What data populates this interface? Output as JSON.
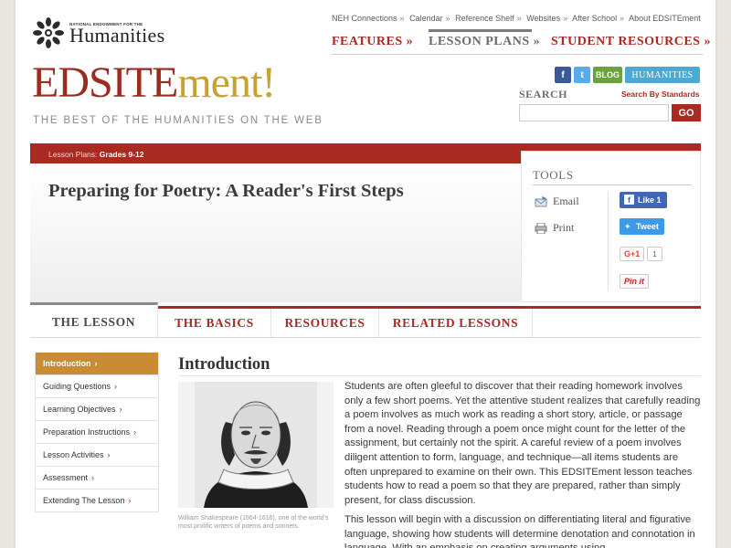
{
  "neh": {
    "small": "NATIONAL ENDOWMENT FOR THE",
    "big": "Humanities"
  },
  "top_links": [
    "NEH Connections",
    "Calendar",
    "Reference Shelf",
    "Websites",
    "After School",
    "About EDSITEment"
  ],
  "main_nav": {
    "features": "FEATURES »",
    "lesson_plans": "LESSON PLANS »",
    "student_resources": "STUDENT RESOURCES »"
  },
  "brand": {
    "part1": "EDSITE",
    "part2": "ment!",
    "tagline": "THE BEST OF THE HUMANITIES ON THE WEB"
  },
  "social": {
    "facebook": "f",
    "twitter": "t",
    "blog": "BLOG",
    "humanities": "HUMANITIES"
  },
  "search": {
    "label": "SEARCH",
    "by_standards": "Search By Standards",
    "placeholder": "",
    "go": "GO"
  },
  "breadcrumb": {
    "prefix": "Lesson Plans:",
    "grades": "Grades 9-12"
  },
  "page_title": "Preparing for Poetry: A Reader's First Steps",
  "tools": {
    "title": "TOOLS",
    "email": "Email",
    "print": "Print",
    "like": "Like 1",
    "tweet": "Tweet",
    "gplus": "G+1",
    "gplus_count": "1",
    "pin": "Pin it"
  },
  "tabs": [
    "THE LESSON",
    "THE BASICS",
    "RESOURCES",
    "RELATED LESSONS"
  ],
  "sidebar": [
    {
      "label": "Introduction"
    },
    {
      "label": "Guiding Questions"
    },
    {
      "label": "Learning Objectives"
    },
    {
      "label": "Preparation Instructions"
    },
    {
      "label": "Lesson Activities"
    },
    {
      "label": "Assessment"
    },
    {
      "label": "Extending The Lesson"
    }
  ],
  "content": {
    "section_title": "Introduction",
    "caption": "William Shakespeare (1564-1616), one of the world's most prolific writers of poems and sonnets.",
    "para1": "Students are often gleeful to discover that their reading homework involves only a few short poems. Yet the attentive student realizes that carefully reading a poem involves as much work as reading a short story, article, or passage from a novel. Reading through a poem once might count for the letter of the assignment, but certainly not the spirit. A careful review of a poem involves diligent attention to form, language, and technique—all items students are often unprepared to examine on their own. This EDSITEment lesson teaches students how to read a poem so that they are prepared, rather than simply present, for class discussion.",
    "para2": "This lesson will begin with a discussion on differentiating literal and figurative language, showing how students will determine denotation and connotation in language. With an emphasis on creating arguments using"
  },
  "colors": {
    "accent_red": "#a82a20",
    "gold": "#c9a032",
    "active_tab_gold": "#c98c35"
  }
}
